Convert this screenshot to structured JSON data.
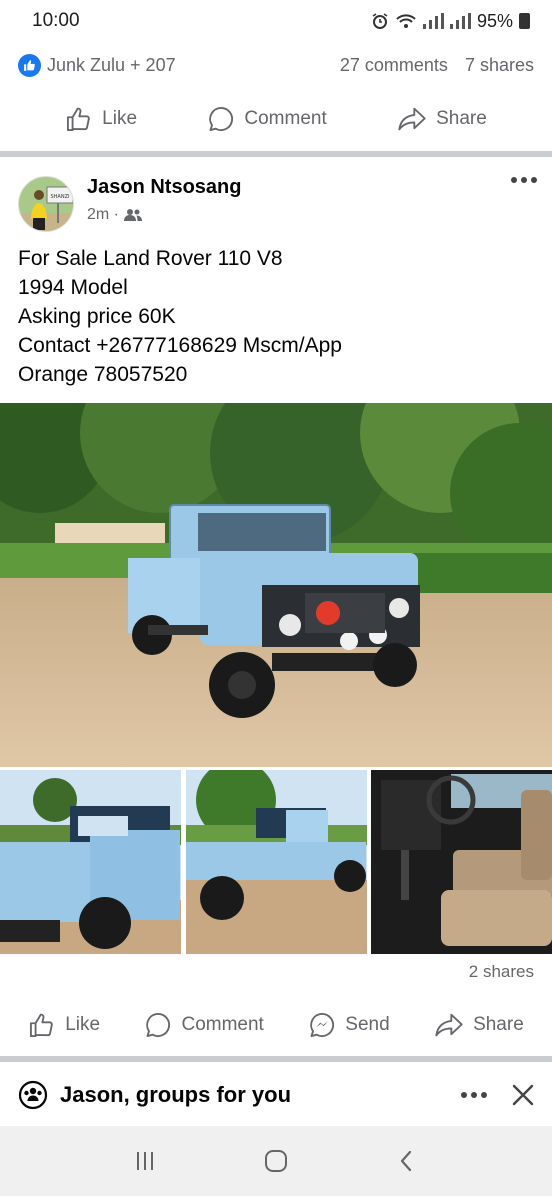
{
  "status": {
    "time": "10:00",
    "battery": "95%"
  },
  "reactions": {
    "names": "Junk Zulu + 207",
    "comments": "27 comments",
    "shares": "7 shares"
  },
  "actions_top": {
    "like": "Like",
    "comment": "Comment",
    "share": "Share"
  },
  "post": {
    "author": "Jason Ntsosang",
    "time": "2m ·",
    "audience_icon": "friends-icon",
    "lines": [
      "For Sale Land Rover 110 V8",
      "1994 Model",
      "Asking price 60K",
      "Contact +26777168629 Mscm/App",
      "Orange 78057520"
    ],
    "avatar_sign_text": "SHANZI",
    "shares": "2 shares"
  },
  "actions_bottom": {
    "like": "Like",
    "comment": "Comment",
    "send": "Send",
    "share": "Share"
  },
  "groups": {
    "title": "Jason, groups for you"
  },
  "colors": {
    "brand_blue": "#1877f2",
    "text_secondary": "#65676b",
    "divider": "#c9ccd1",
    "vehicle_blue": "#9cc8e8"
  }
}
